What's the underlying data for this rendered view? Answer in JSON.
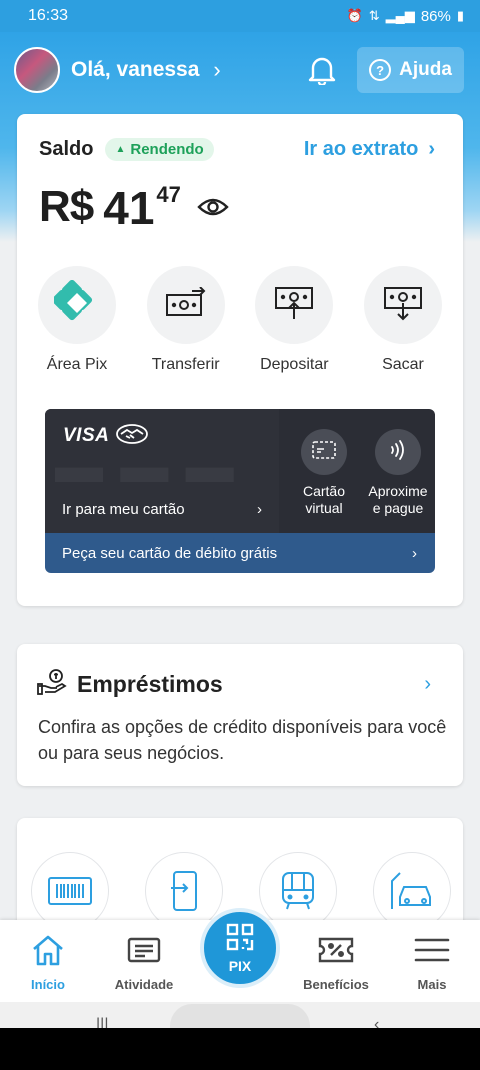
{
  "status_bar": {
    "time": "16:33",
    "battery": "86%",
    "icons": [
      "alarm-icon",
      "data-icon",
      "signal-icon",
      "battery-icon"
    ]
  },
  "header": {
    "greeting": "Olá, vanessa",
    "help_label": "Ajuda",
    "help_icon_glyph": "?"
  },
  "balance": {
    "label": "Saldo",
    "badge": "Rendendo",
    "extrato_link": "Ir ao extrato",
    "currency": "R$",
    "amount_int": "41",
    "amount_cents": "47"
  },
  "actions": [
    {
      "label": "Área Pix",
      "icon": "pix-icon"
    },
    {
      "label": "Transferir",
      "icon": "transfer-icon"
    },
    {
      "label": "Depositar",
      "icon": "deposit-icon"
    },
    {
      "label": "Sacar",
      "icon": "withdraw-icon"
    }
  ],
  "debit_card": {
    "brand": "VISA",
    "go_to_card": "Ir para meu cartão",
    "virtual_card_label": "Cartão\nvirtual",
    "contactless_label": "Aproxime\ne pague",
    "request_card": "Peça seu cartão de débito grátis"
  },
  "loans": {
    "title": "Empréstimos",
    "description": "Confira as opções de crédito disponíveis para você ou para seus negócios."
  },
  "services": [
    "barcode-icon",
    "phone-recharge-icon",
    "transport-icon",
    "car-icon"
  ],
  "bottom_nav": [
    {
      "label": "Início",
      "icon": "home-icon",
      "active": true
    },
    {
      "label": "Atividade",
      "icon": "activity-icon",
      "active": false
    },
    {
      "label": "PIX",
      "icon": "qr-code-icon",
      "active": false
    },
    {
      "label": "Benefícios",
      "icon": "coupon-icon",
      "active": false
    },
    {
      "label": "Mais",
      "icon": "menu-icon",
      "active": false
    }
  ],
  "colors": {
    "brand_blue": "#2d9fe0",
    "pix_teal": "#32bcad",
    "green": "#1ea15a",
    "card_dark": "#2b2d35",
    "card_strip": "#2f5a8c"
  }
}
